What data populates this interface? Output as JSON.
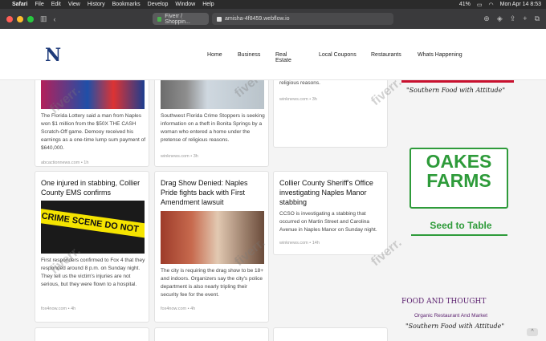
{
  "menubar": {
    "apple": "",
    "app": "Safari",
    "items": [
      "File",
      "Edit",
      "View",
      "History",
      "Bookmarks",
      "Develop",
      "Window",
      "Help"
    ],
    "battery": "41%",
    "datetime": "Mon Apr 14  8:53"
  },
  "toolbar": {
    "tab1": "Fiverr / Shoppin...",
    "tab2": "amisha-4f8459.webflow.io"
  },
  "site": {
    "logo": "N",
    "nav": [
      "Home",
      "Business",
      "Real Estate",
      "Local Coupons",
      "Restaurants",
      "Whats Happening"
    ]
  },
  "cards": [
    {
      "body": "The Florida Lottery said a man from Naples won $1 million from the $50X THE CASH Scratch-Off game. Demooy received his earnings as a one-time lump sum payment of $640,000.",
      "meta": "abcactionnews.com  •  1h"
    },
    {
      "body": "Southwest Florida Crime Stoppers is seeking information on a theft in Bonita Springs by a woman who entered a home under the pretense of religious reasons.",
      "meta": "winknews.com  •  3h"
    },
    {
      "body": "religious reasons.",
      "meta": "winknews.com  •  3h"
    },
    {
      "title": "One injured in stabbing, Collier County EMS confirms",
      "body": "First responders confirmed to Fox 4 that they responded around 8 p.m. on Sunday night. They tell us the victim's injuries are not serious, but they were flown to a hospital.",
      "meta": "fox4now.com  •  4h"
    },
    {
      "title": "Drag Show Denied: Naples Pride fights back with First Amendment lawsuit",
      "body": "The city is requiring the drag show to be 18+ and indoors. Organizers say the city's police department is also nearly tripling their security fee for the event.",
      "meta": "fox4now.com  •  4h"
    },
    {
      "title": "Collier County Sheriff's Office investigating Naples Manor stabbing",
      "body": "CCSO is investigating a stabbing that occurred on Martin Street and Carolina Avenue in Naples Manor on Sunday night.",
      "meta": "winknews.com  •  14h"
    }
  ],
  "ads": {
    "tagline1": "\"Southern Food with Attitude\"",
    "oakes1": "OAKES",
    "oakes2": "FARMS",
    "seed": "Seed to Table",
    "fat": "FOOD AND THOUGHT",
    "fat_sub": "Organic Restaurant And Market",
    "tagline2": "\"Southern Food with Attitude\""
  },
  "crime_tape": "CRIME SCENE DO NOT",
  "watermark": "fiverr.",
  "colors": {
    "navy": "#1d3a7a",
    "green": "#2e9b3a",
    "crime": "#f5e400"
  }
}
